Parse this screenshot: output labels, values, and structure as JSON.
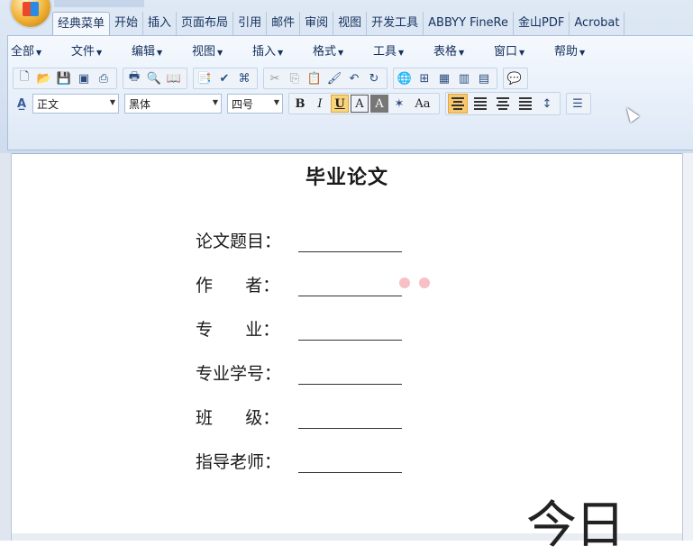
{
  "ribbon": {
    "tabs": [
      "经典菜单",
      "开始",
      "插入",
      "页面布局",
      "引用",
      "邮件",
      "审阅",
      "视图",
      "开发工具",
      "ABBYY FineRe",
      "金山PDF",
      "Acrobat"
    ],
    "active_tab": "经典菜单",
    "menus": [
      "全部",
      "文件",
      "编辑",
      "视图",
      "插入",
      "格式",
      "工具",
      "表格",
      "窗口",
      "帮助"
    ],
    "style_combo": "正文",
    "font_combo": "黑体",
    "size_combo": "四号",
    "format_buttons": {
      "bold": "B",
      "italic": "I",
      "underline": "U",
      "boxed": "A",
      "shaded": "A",
      "case": "Aa"
    }
  },
  "document": {
    "title": "毕业论文",
    "fields": [
      {
        "label": "论文题目："
      },
      {
        "label": "作      者："
      },
      {
        "label": "专      业："
      },
      {
        "label": "专业学号："
      },
      {
        "label": "班      级："
      },
      {
        "label": "指导老师："
      }
    ]
  },
  "watermark_text": "今日",
  "colors": {
    "ribbon": "#cfdcee",
    "active_button": "#f9c86b",
    "dots": "#f7c0c6"
  }
}
